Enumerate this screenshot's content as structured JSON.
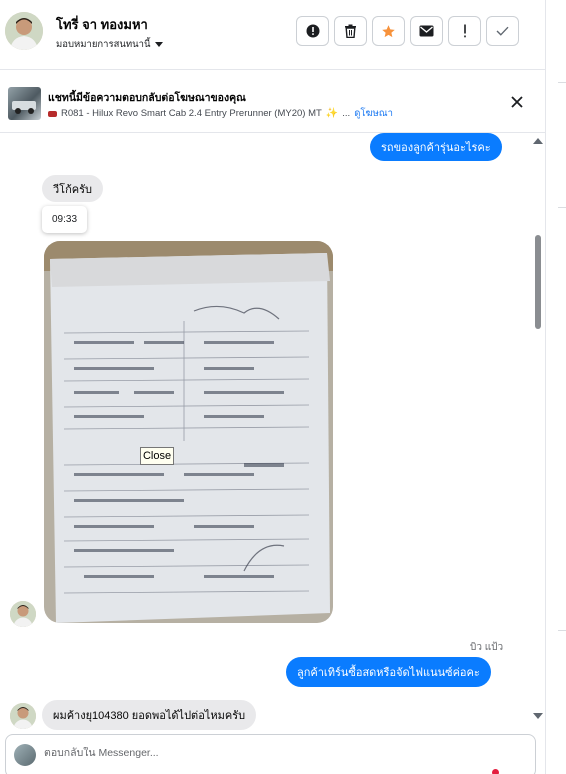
{
  "header": {
    "contact_name": "โทรี่ จา ทองมหา",
    "assign_label": "มอบหมายการสนทนานี้",
    "actions": [
      {
        "name": "report",
        "icon": "exclamation-circle-icon"
      },
      {
        "name": "delete",
        "icon": "trash-icon"
      },
      {
        "name": "star",
        "icon": "star-icon",
        "color": "#f7923b"
      },
      {
        "name": "mark-unread",
        "icon": "envelope-icon"
      },
      {
        "name": "important",
        "icon": "exclamation-icon"
      },
      {
        "name": "done",
        "icon": "check-icon"
      }
    ]
  },
  "banner": {
    "title": "แชทนี้มีข้อความตอบกลับต่อโฆษณาของคุณ",
    "ad_text": "R081 - Hilux Revo Smart Cab 2.4 Entry Prerunner (MY20) MT",
    "ellipsis": "...",
    "link_label": "ดูโฆษณา"
  },
  "messages": {
    "out_1": "รถของลูกค้ารุ่นอะไรคะ",
    "in_1": "วีโก้ครับ",
    "timestamp": "09:33",
    "tooltip": "Close",
    "sender_label": "บิว แป้ว",
    "out_2": "ลูกค้าเทิร์นซื้อสดหรือจัดไฟแนนซ์ค่อคะ",
    "in_2": "ผมค้างยุ104380 ยอดพอได้ไปต่อไหมครับ"
  },
  "composer": {
    "placeholder": "ตอบกลับใน Messenger..."
  },
  "colors": {
    "accent": "#0a7cff",
    "incoming_bubble": "#e9e9eb",
    "star": "#f7923b"
  }
}
